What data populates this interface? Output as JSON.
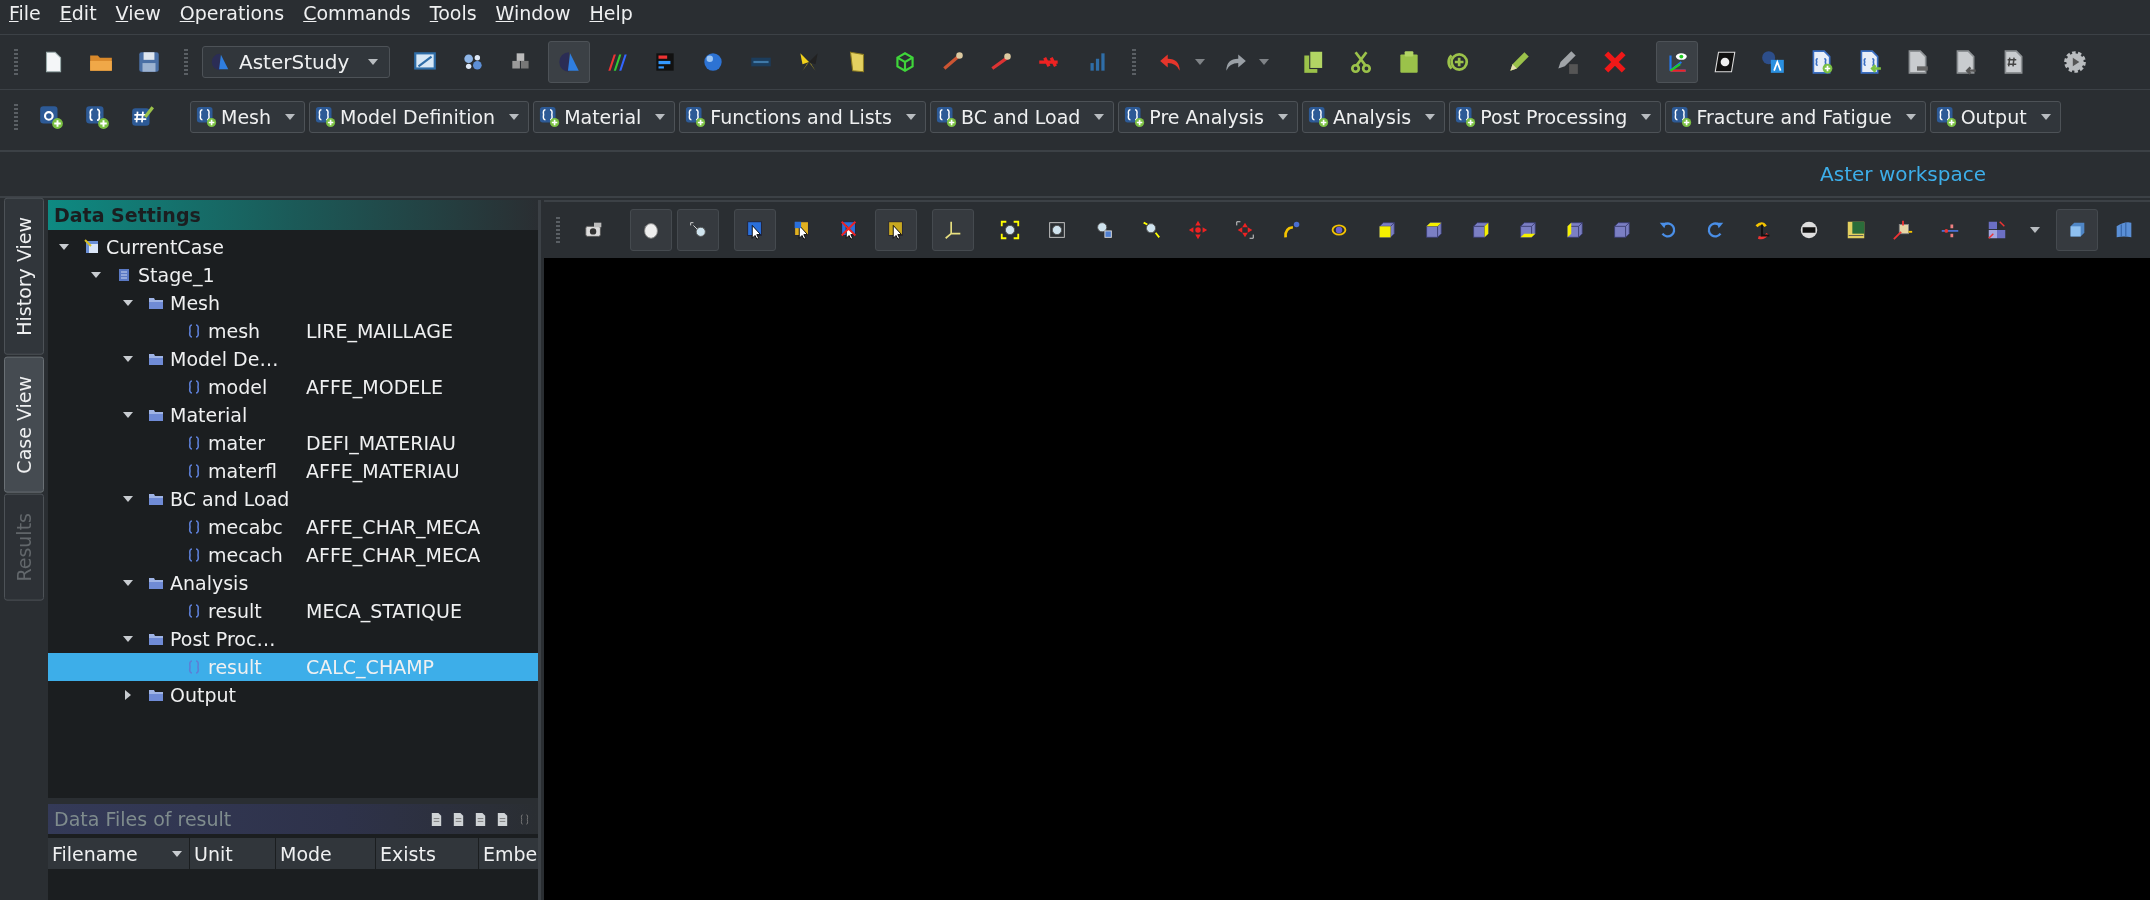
{
  "menu": [
    "File",
    "Edit",
    "View",
    "Operations",
    "Commands",
    "Tools",
    "Window",
    "Help"
  ],
  "main_toolbar": {
    "module": "AsterStudy",
    "modules": [
      {
        "selected": false
      },
      {
        "selected": false
      },
      {
        "selected": false
      },
      {
        "selected": true
      },
      {
        "selected": false
      },
      {
        "selected": false
      },
      {
        "selected": false
      },
      {
        "selected": false
      },
      {
        "selected": false
      },
      {
        "selected": false
      },
      {
        "selected": false
      },
      {
        "selected": false
      },
      {
        "selected": false
      },
      {
        "selected": false
      },
      {
        "selected": false
      }
    ],
    "view_toggle": {
      "on": true
    }
  },
  "categories": [
    "Mesh",
    "Model Definition",
    "Material",
    "Functions and Lists",
    "BC and Load",
    "Pre Analysis",
    "Analysis",
    "Post Processing",
    "Fracture and Fatigue",
    "Output"
  ],
  "workspace_label": "Aster workspace",
  "side_tabs": [
    {
      "label": "History View",
      "selected": false,
      "disabled": false
    },
    {
      "label": "Case View",
      "selected": true,
      "disabled": false
    },
    {
      "label": "Results",
      "selected": false,
      "disabled": true
    }
  ],
  "data_settings": {
    "title": "Data Settings",
    "tree": [
      {
        "label": "CurrentCase",
        "kind": "case",
        "expanded": true,
        "selected": false,
        "children": [
          {
            "label": "Stage_1",
            "kind": "stage",
            "expanded": true,
            "selected": false,
            "children": [
              {
                "label": "Mesh",
                "kind": "category",
                "expanded": true,
                "selected": false,
                "children": [
                  {
                    "label": "mesh",
                    "command": "LIRE_MAILLAGE",
                    "kind": "command",
                    "selected": false
                  }
                ]
              },
              {
                "label": "Model De…",
                "kind": "category",
                "expanded": true,
                "selected": false,
                "children": [
                  {
                    "label": "model",
                    "command": "AFFE_MODELE",
                    "kind": "command",
                    "selected": false
                  }
                ]
              },
              {
                "label": "Material",
                "kind": "category",
                "expanded": true,
                "selected": false,
                "children": [
                  {
                    "label": "mater",
                    "command": "DEFI_MATERIAU",
                    "kind": "command",
                    "selected": false
                  },
                  {
                    "label": "materfl",
                    "command": "AFFE_MATERIAU",
                    "kind": "command",
                    "selected": false
                  }
                ]
              },
              {
                "label": "BC and Load",
                "kind": "category",
                "expanded": true,
                "selected": false,
                "children": [
                  {
                    "label": "mecabc",
                    "command": "AFFE_CHAR_MECA",
                    "kind": "command",
                    "selected": false
                  },
                  {
                    "label": "mecach",
                    "command": "AFFE_CHAR_MECA",
                    "kind": "command",
                    "selected": false
                  }
                ]
              },
              {
                "label": "Analysis",
                "kind": "category",
                "expanded": true,
                "selected": false,
                "children": [
                  {
                    "label": "result",
                    "command": "MECA_STATIQUE",
                    "kind": "command",
                    "selected": false
                  }
                ]
              },
              {
                "label": "Post Proc…",
                "kind": "category",
                "expanded": true,
                "selected": false,
                "children": [
                  {
                    "label": "result",
                    "command": "CALC_CHAMP",
                    "kind": "command",
                    "selected": true
                  }
                ]
              },
              {
                "label": "Output",
                "kind": "category",
                "expanded": false,
                "selected": false
              }
            ]
          }
        ]
      }
    ]
  },
  "data_files": {
    "title": "Data Files of result",
    "columns": [
      "Filename",
      "Unit",
      "Mode",
      "Exists",
      "Embe"
    ]
  },
  "viewer_tools": [
    {
      "on": false
    },
    {
      "on": true
    },
    {
      "on": true
    },
    {
      "on": true
    },
    {
      "on": false
    },
    {
      "on": false
    },
    {
      "on": true
    },
    {
      "on": true
    },
    {
      "on": false
    },
    {
      "on": false
    },
    {
      "on": false
    },
    {
      "on": false
    },
    {
      "on": false
    },
    {
      "on": false
    },
    {
      "on": false
    },
    {
      "on": false
    },
    {
      "on": false
    },
    {
      "on": false
    },
    {
      "on": false
    },
    {
      "on": false
    },
    {
      "on": false
    },
    {
      "on": false
    },
    {
      "on": false
    },
    {
      "on": false
    },
    {
      "on": false
    },
    {
      "on": false
    },
    {
      "on": false
    },
    {
      "on": false
    },
    {
      "on": false
    },
    {
      "on": false
    },
    {
      "on": true
    },
    {
      "on": false
    }
  ]
}
